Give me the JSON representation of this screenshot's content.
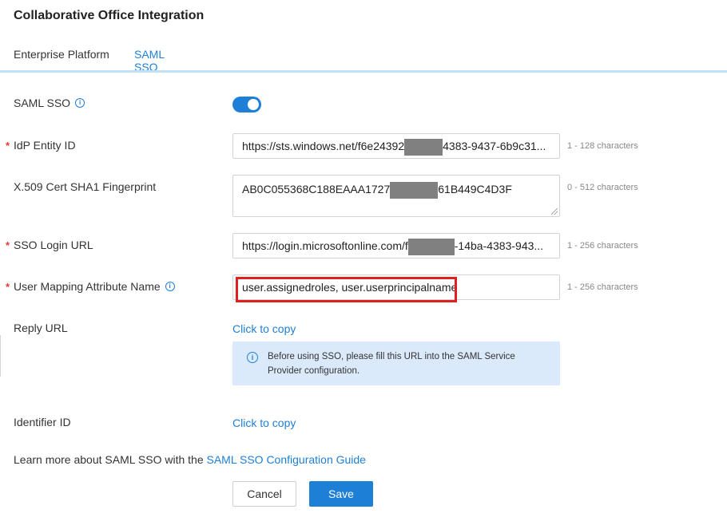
{
  "page": {
    "title": "Collaborative Office Integration"
  },
  "tabs": [
    {
      "label": "Enterprise Platform",
      "active": false
    },
    {
      "label": "SAML SSO",
      "active": true
    }
  ],
  "saml_sso": {
    "label": "SAML SSO",
    "enabled": true,
    "info_icon": "info-icon"
  },
  "fields": {
    "idp_entity_id": {
      "label": "IdP Entity ID",
      "required": true,
      "value_prefix": "https://sts.windows.net/f6e24392",
      "value_suffix": "4383-9437-6b9c31...",
      "hint": "1 - 128 characters"
    },
    "cert_fingerprint": {
      "label": "X.509 Cert SHA1 Fingerprint",
      "required": false,
      "value_prefix": "AB0C055368C188EAAA1727",
      "value_suffix": "61B449C4D3F",
      "hint": "0 - 512 characters"
    },
    "sso_login_url": {
      "label": "SSO Login URL",
      "required": true,
      "value_prefix": "https://login.microsoftonline.com/f",
      "value_suffix": "-14ba-4383-943...",
      "hint": "1 - 256 characters"
    },
    "user_mapping": {
      "label": "User Mapping Attribute Name",
      "required": true,
      "value": "user.assignedroles, user.userprincipalname",
      "hint": "1 - 256 characters"
    }
  },
  "required_marker": "*",
  "reply_url": {
    "label": "Reply URL",
    "link": "Click to copy",
    "notice": "Before using SSO, please fill this URL into the SAML Service Provider configuration."
  },
  "identifier_id": {
    "label": "Identifier ID",
    "link": "Click to copy"
  },
  "learn_more": {
    "text": "Learn more about SAML SSO with the ",
    "link": "SAML SSO Configuration Guide"
  },
  "buttons": {
    "cancel": "Cancel",
    "save": "Save"
  },
  "colors": {
    "accent": "#1e7fd6",
    "required": "#e53935",
    "highlight": "#e02020",
    "notice_bg": "#dbeafb"
  }
}
